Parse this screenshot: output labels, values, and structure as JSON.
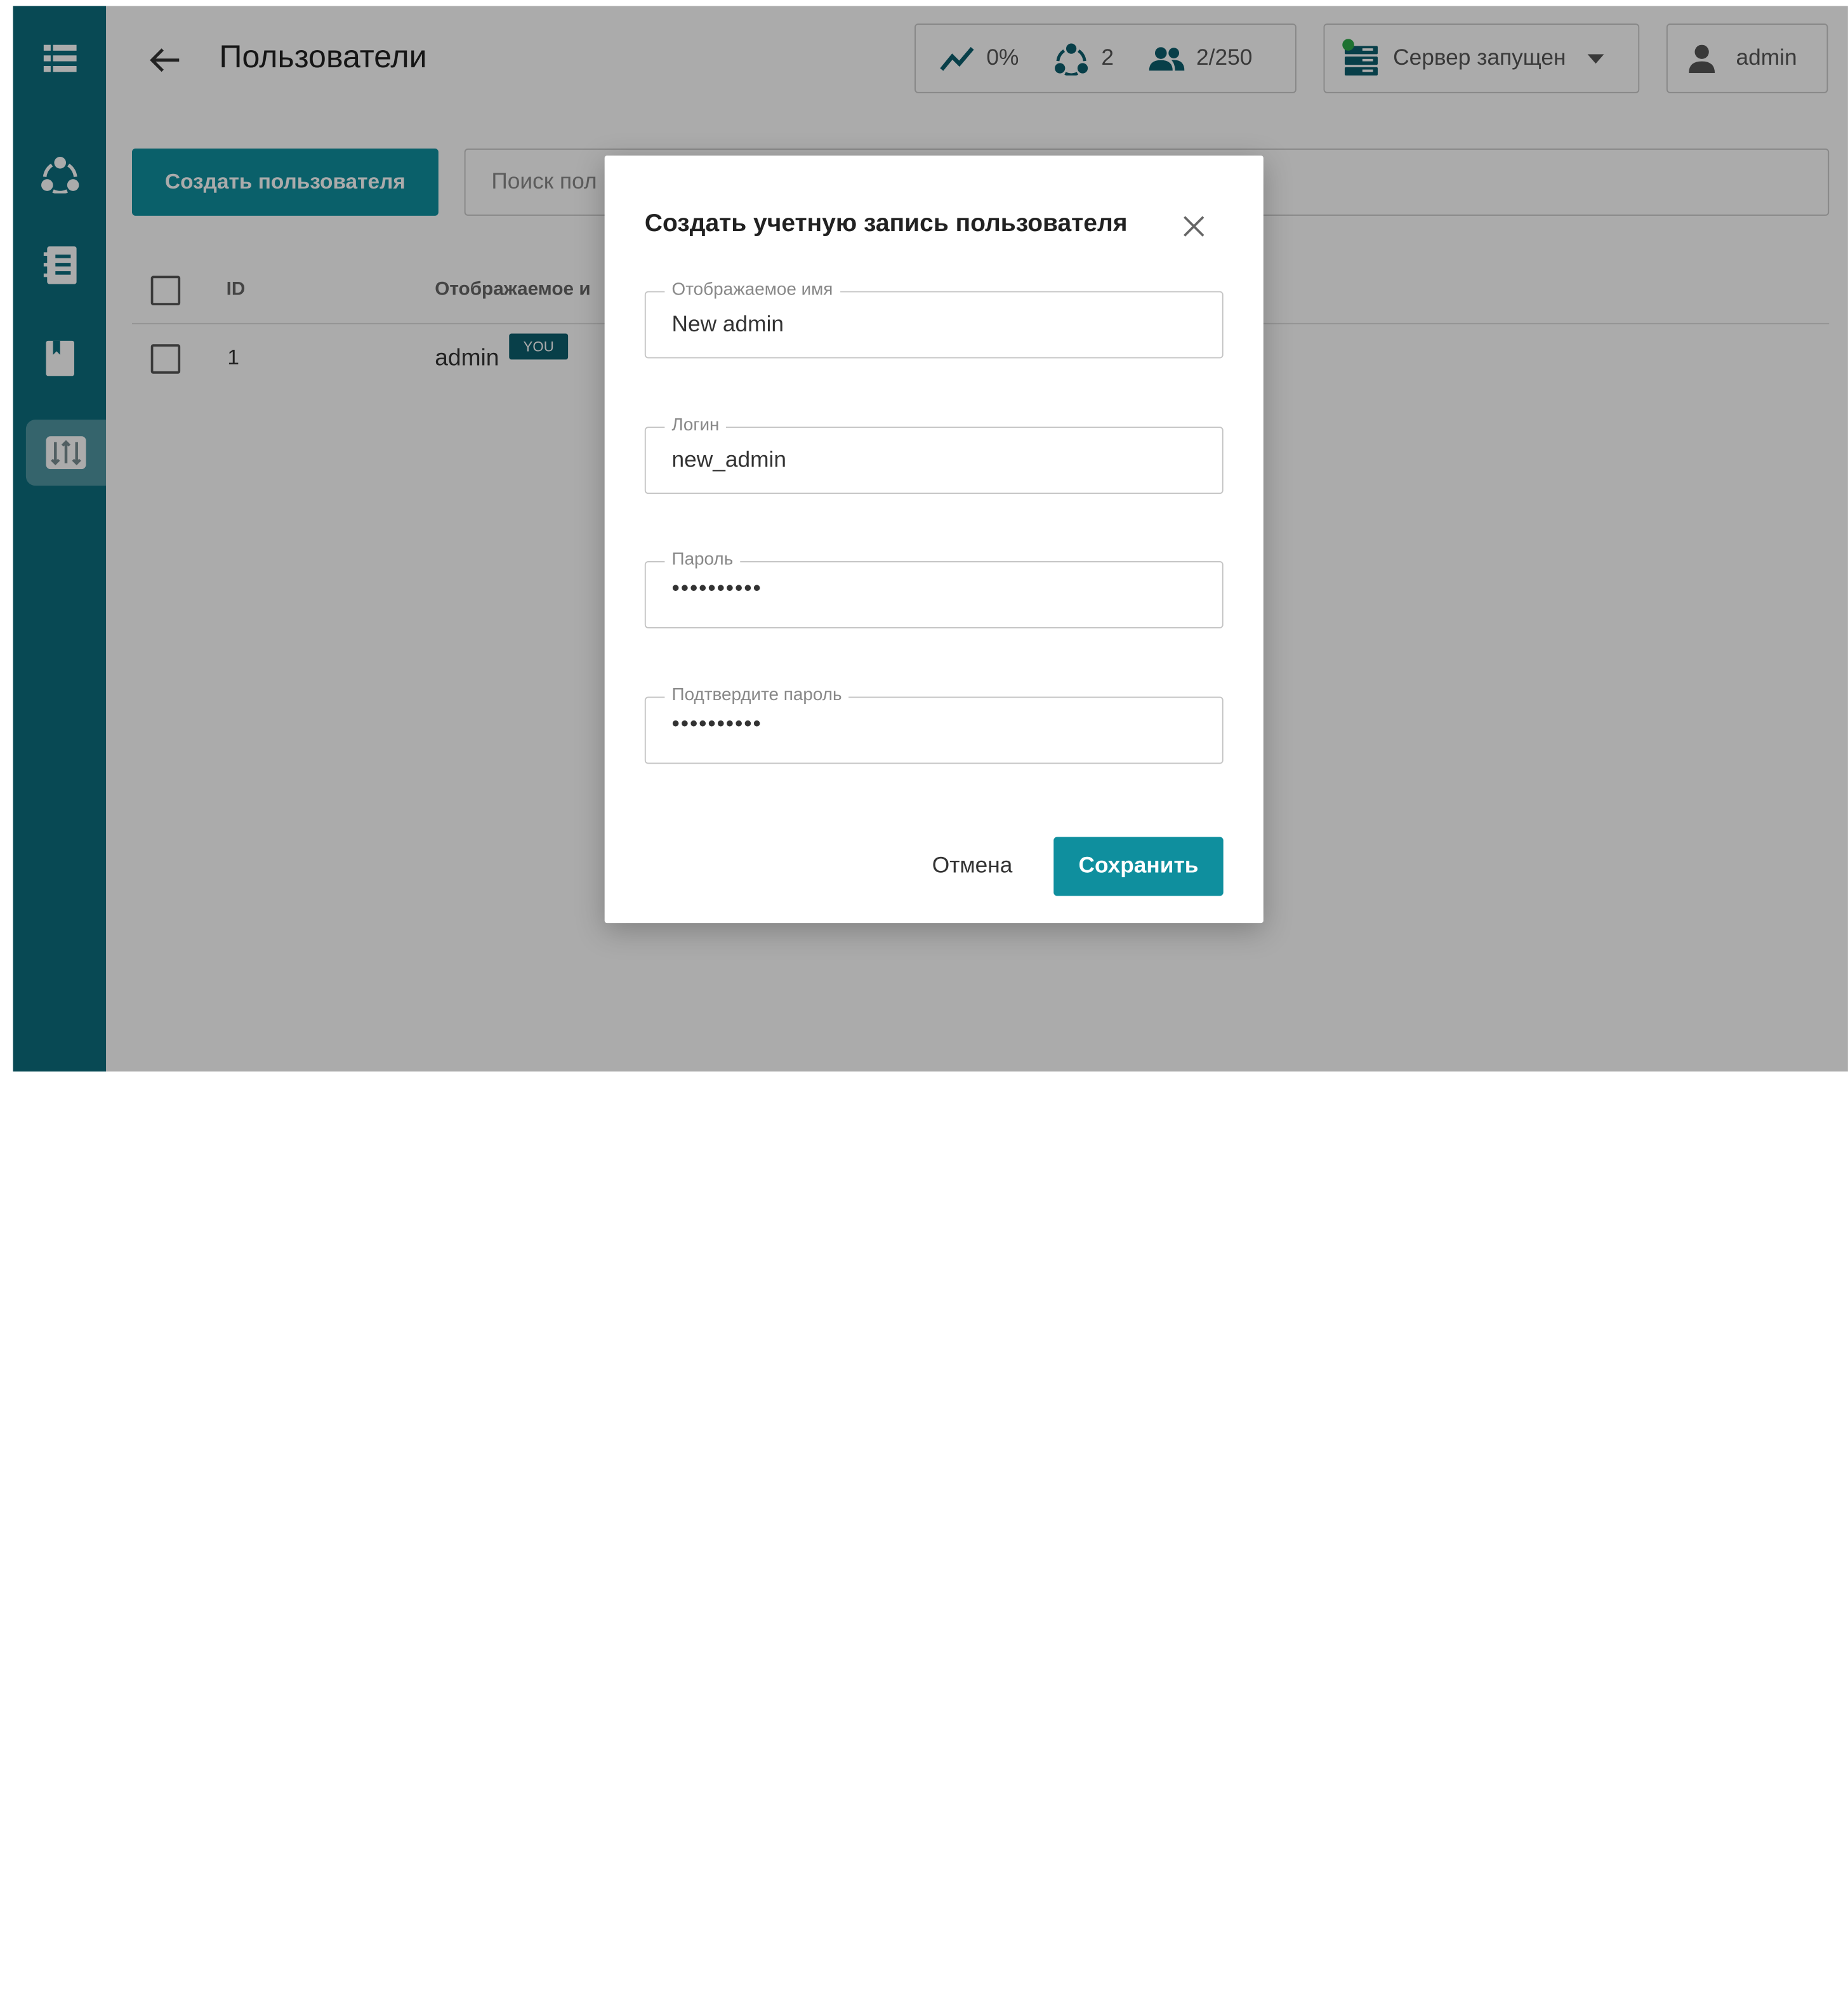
{
  "header": {
    "title": "Пользователи",
    "stats": [
      {
        "icon": "trend-icon",
        "value": "0%"
      },
      {
        "icon": "nodes-icon",
        "value": "2"
      },
      {
        "icon": "users-icon",
        "value": "2/250"
      }
    ],
    "server_status": "Сервер запущен",
    "current_user": "admin"
  },
  "toolbar": {
    "create_label": "Создать пользователя",
    "search_placeholder": "Поиск пол"
  },
  "table": {
    "columns": [
      "ID",
      "Отображаемое и"
    ],
    "rows": [
      {
        "id": "1",
        "name": "admin",
        "badge": "YOU"
      }
    ]
  },
  "modal": {
    "title": "Создать учетную запись пользователя",
    "fields": [
      {
        "label": "Отображаемое имя",
        "value": "New admin"
      },
      {
        "label": "Логин",
        "value": "new_admin"
      },
      {
        "label": "Пароль",
        "value": "••••••••••"
      },
      {
        "label": "Подтвердите пароль",
        "value": "••••••••••"
      }
    ],
    "cancel_label": "Отмена",
    "save_label": "Сохранить"
  },
  "colors": {
    "sidebar": "#0c6e7e",
    "accent": "#0f8f9e",
    "badge": "#0c5e6e",
    "server_ok": "#2eaa4a"
  }
}
